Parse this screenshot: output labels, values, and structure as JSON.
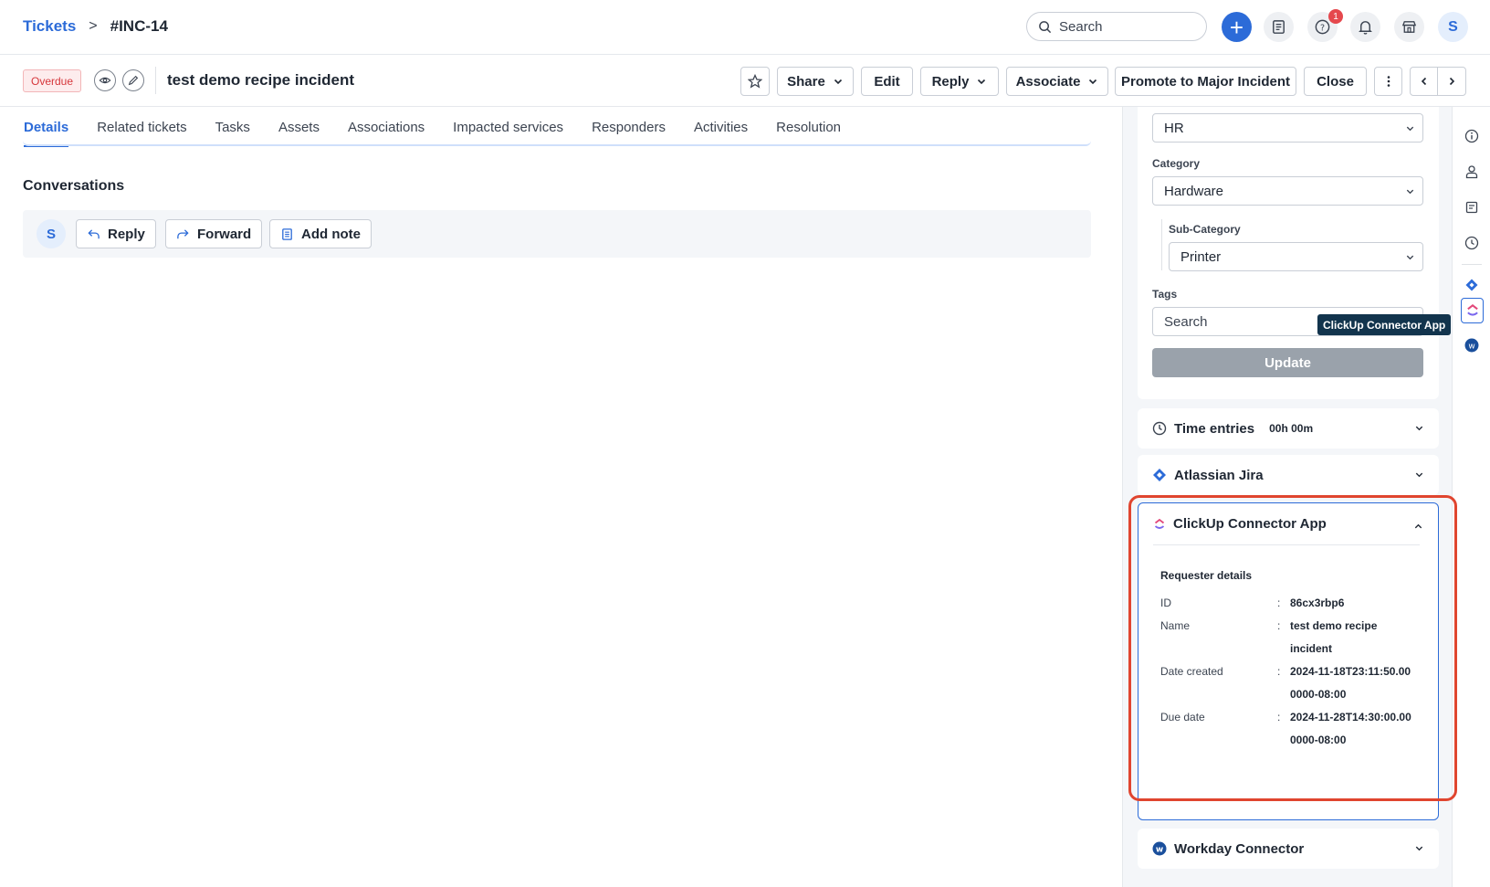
{
  "breadcrumb": {
    "root": "Tickets",
    "separator": ">",
    "current": "#INC-14"
  },
  "topbar": {
    "search_placeholder": "Search",
    "notification_count": "1",
    "user_initial": "S"
  },
  "ticket": {
    "status_badge": "Overdue",
    "title": "test demo recipe incident",
    "actions": {
      "share": "Share",
      "edit": "Edit",
      "reply": "Reply",
      "associate": "Associate",
      "promote": "Promote to Major Incident",
      "close": "Close"
    }
  },
  "tabs": [
    "Details",
    "Related tickets",
    "Tasks",
    "Assets",
    "Associations",
    "Impacted services",
    "Responders",
    "Activities",
    "Resolution"
  ],
  "conversations": {
    "title": "Conversations",
    "avatar_initial": "S",
    "reply": "Reply",
    "forward": "Forward",
    "add_note": "Add note"
  },
  "properties": {
    "department_value": "HR",
    "category_label": "Category",
    "category_value": "Hardware",
    "subcategory_label": "Sub-Category",
    "subcategory_value": "Printer",
    "tags_label": "Tags",
    "tags_placeholder": "Search",
    "update_button": "Update"
  },
  "time_entries": {
    "label": "Time entries",
    "value": "00h 00m"
  },
  "jira": {
    "label": "Atlassian Jira"
  },
  "clickup": {
    "title": "ClickUp Connector App",
    "tooltip": "ClickUp Connector App",
    "section": "Requester details",
    "rows": [
      {
        "key": "ID",
        "sep": ":",
        "value": "86cx3rbp6"
      },
      {
        "key": "Name",
        "sep": ":",
        "value": "test demo recipe incident"
      },
      {
        "key": "Date created",
        "sep": ":",
        "value": "2024-11-18T23:11:50.000000-08:00"
      },
      {
        "key": "Due date",
        "sep": ":",
        "value": "2024-11-28T14:30:00.000000-08:00"
      }
    ]
  },
  "workday": {
    "label": "Workday Connector"
  },
  "colors": {
    "accent": "#2c6bd8",
    "overdue": "#d6363b",
    "highlight": "#e0452f",
    "tooltip_bg": "#12344d"
  }
}
